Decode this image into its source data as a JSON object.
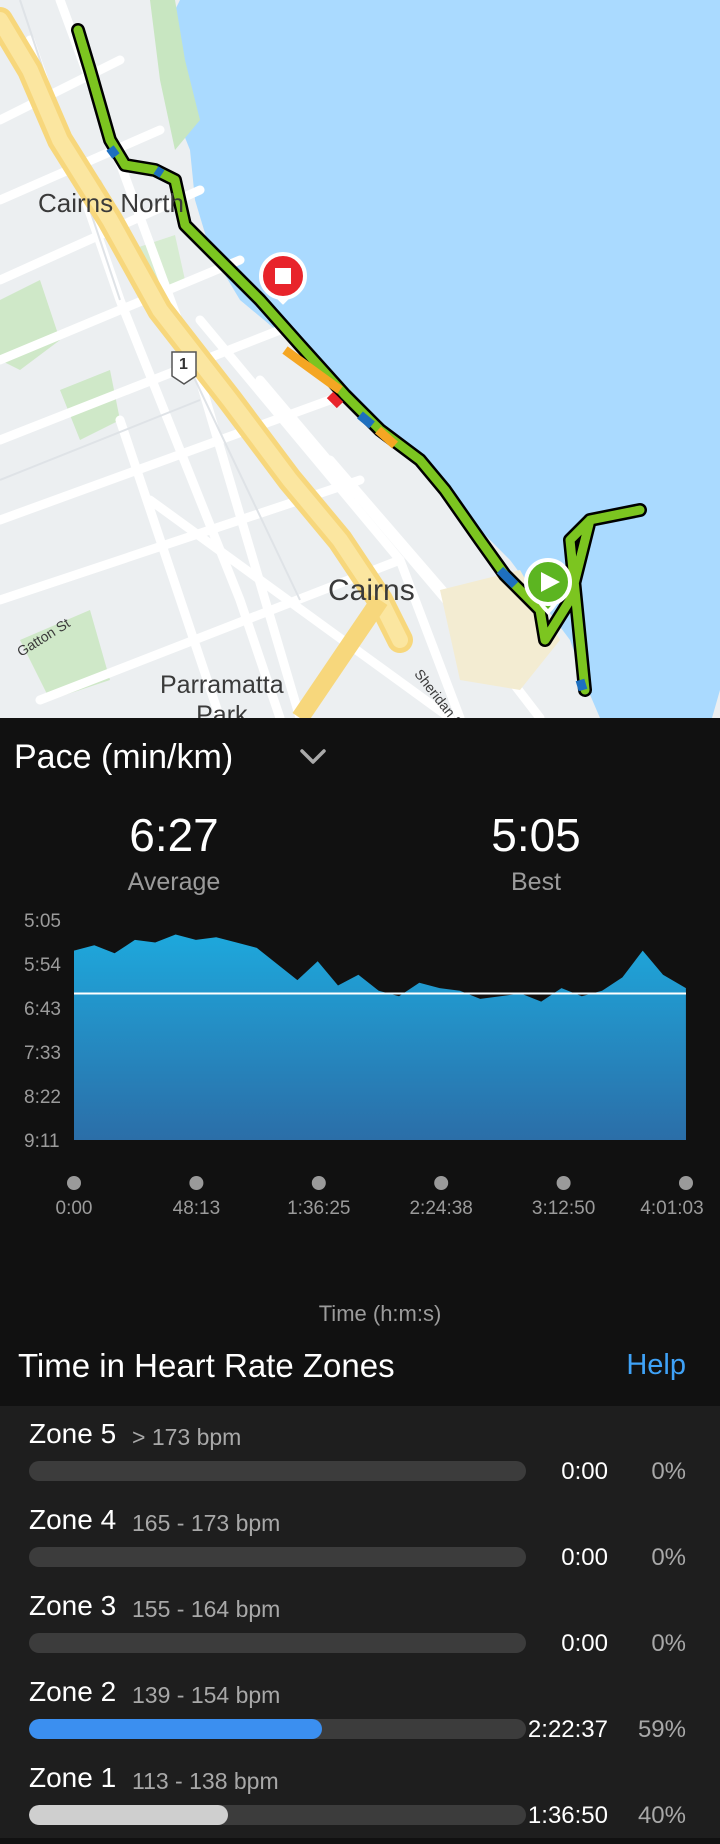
{
  "map": {
    "labels": {
      "cairns_north": "Cairns North",
      "cairns": "Cairns",
      "parramatta_park": "Parramatta\nPark",
      "gatton_st": "Gatton St",
      "sheridan_st": "Sheridan St",
      "route_shield": "1"
    },
    "start_marker_icon": "play-icon",
    "end_marker_icon": "stop-icon",
    "colors": {
      "water": "#aadaff",
      "route": "#7cc520",
      "start": "#5cb521",
      "end": "#e8242b"
    }
  },
  "pace": {
    "title": "Pace (min/km)",
    "dropdown_icon": "chevron-down-icon",
    "average": {
      "value": "6:27",
      "label": "Average"
    },
    "best": {
      "value": "5:05",
      "label": "Best"
    }
  },
  "chart_data": {
    "type": "area",
    "title": "Pace (min/km)",
    "xlabel": "Time (h:m:s)",
    "ylabel": "",
    "y_ticks": [
      "5:05",
      "5:54",
      "6:43",
      "7:33",
      "8:22",
      "9:11"
    ],
    "x_ticks": [
      "0:00",
      "48:13",
      "1:36:25",
      "2:24:38",
      "3:12:50",
      "4:01:03"
    ],
    "y_range_minutes": [
      5.08,
      9.18
    ],
    "x_range_seconds": [
      0,
      14463
    ],
    "average_line": "6:27",
    "grid": false,
    "series": [
      {
        "x_minutes": [
          0,
          8,
          16,
          24,
          32,
          40,
          48,
          56,
          64,
          72,
          80,
          88,
          96,
          104,
          112,
          120,
          128,
          136,
          144,
          152,
          160,
          168,
          176,
          184,
          192,
          200,
          208,
          216,
          224,
          232,
          241
        ],
        "pace_minutes": [
          5.65,
          5.55,
          5.7,
          5.45,
          5.5,
          5.35,
          5.45,
          5.4,
          5.5,
          5.6,
          5.9,
          6.2,
          5.85,
          6.3,
          6.1,
          6.4,
          6.5,
          6.25,
          6.35,
          6.4,
          6.55,
          6.5,
          6.45,
          6.6,
          6.35,
          6.5,
          6.4,
          6.15,
          5.65,
          6.1,
          6.35
        ]
      }
    ],
    "colors": {
      "fill_top": "#1ea8dc",
      "fill_bottom": "#2b6ea8",
      "average_line": "#ffffff"
    }
  },
  "heart_rate": {
    "title": "Time in Heart Rate Zones",
    "help_label": "Help",
    "zones": [
      {
        "name": "Zone 5",
        "range": "> 173 bpm",
        "time": "0:00",
        "percent": "0%",
        "fraction": 0,
        "color": "#3c3c3c"
      },
      {
        "name": "Zone 4",
        "range": "165 - 173 bpm",
        "time": "0:00",
        "percent": "0%",
        "fraction": 0,
        "color": "#3c3c3c"
      },
      {
        "name": "Zone 3",
        "range": "155 - 164 bpm",
        "time": "0:00",
        "percent": "0%",
        "fraction": 0,
        "color": "#3c3c3c"
      },
      {
        "name": "Zone 2",
        "range": "139 - 154 bpm",
        "time": "2:22:37",
        "percent": "59%",
        "fraction": 0.59,
        "color": "#3b8ff0"
      },
      {
        "name": "Zone 1",
        "range": "113 - 138 bpm",
        "time": "1:36:50",
        "percent": "40%",
        "fraction": 0.4,
        "color": "#cfcfcf"
      }
    ]
  }
}
